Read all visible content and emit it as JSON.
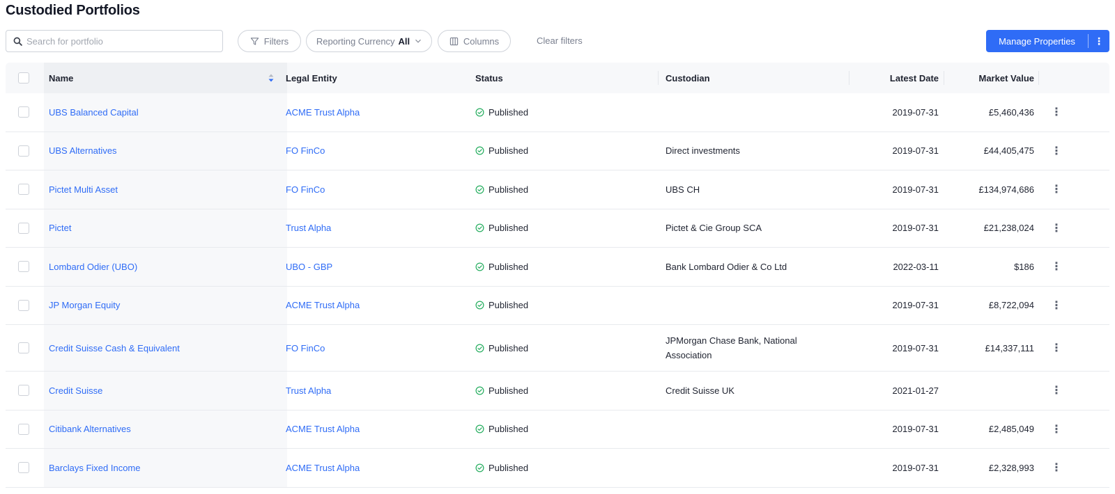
{
  "page": {
    "title": "Custodied Portfolios"
  },
  "toolbar": {
    "search_placeholder": "Search for portfolio",
    "filters_label": "Filters",
    "currency_label": "Reporting Currency",
    "currency_value": "All",
    "columns_label": "Columns",
    "clear_filters_label": "Clear filters",
    "manage_properties_label": "Manage Properties"
  },
  "table": {
    "headers": {
      "name": "Name",
      "legal_entity": "Legal Entity",
      "status": "Status",
      "custodian": "Custodian",
      "latest_date": "Latest Date",
      "market_value": "Market Value"
    },
    "rows": [
      {
        "name": "UBS Balanced Capital",
        "legal_entity": "ACME Trust Alpha",
        "status": "Published",
        "custodian": "",
        "latest_date": "2019-07-31",
        "market_value": "£5,460,436"
      },
      {
        "name": "UBS Alternatives",
        "legal_entity": "FO FinCo",
        "status": "Published",
        "custodian": "Direct investments",
        "latest_date": "2019-07-31",
        "market_value": "£44,405,475"
      },
      {
        "name": "Pictet Multi Asset",
        "legal_entity": "FO FinCo",
        "status": "Published",
        "custodian": "UBS CH",
        "latest_date": "2019-07-31",
        "market_value": "£134,974,686"
      },
      {
        "name": "Pictet",
        "legal_entity": "Trust Alpha",
        "status": "Published",
        "custodian": "Pictet & Cie Group SCA",
        "latest_date": "2019-07-31",
        "market_value": "£21,238,024"
      },
      {
        "name": "Lombard Odier (UBO)",
        "legal_entity": "UBO - GBP",
        "status": "Published",
        "custodian": "Bank Lombard Odier & Co Ltd",
        "latest_date": "2022-03-11",
        "market_value": "$186"
      },
      {
        "name": "JP Morgan Equity",
        "legal_entity": "ACME Trust Alpha",
        "status": "Published",
        "custodian": "",
        "latest_date": "2019-07-31",
        "market_value": "£8,722,094"
      },
      {
        "name": "Credit Suisse Cash & Equivalent",
        "legal_entity": "FO FinCo",
        "status": "Published",
        "custodian": "JPMorgan Chase Bank, National Association",
        "latest_date": "2019-07-31",
        "market_value": "£14,337,111"
      },
      {
        "name": "Credit Suisse",
        "legal_entity": "Trust Alpha",
        "status": "Published",
        "custodian": "Credit Suisse UK",
        "latest_date": "2021-01-27",
        "market_value": ""
      },
      {
        "name": "Citibank Alternatives",
        "legal_entity": "ACME Trust Alpha",
        "status": "Published",
        "custodian": "",
        "latest_date": "2019-07-31",
        "market_value": "£2,485,049"
      },
      {
        "name": "Barclays Fixed Income",
        "legal_entity": "ACME Trust Alpha",
        "status": "Published",
        "custodian": "",
        "latest_date": "2019-07-31",
        "market_value": "£2,328,993"
      }
    ]
  },
  "colors": {
    "accent": "#2f6cf6",
    "status_ok": "#27ae60",
    "header_bg": "#f7f8fa"
  },
  "icons": [
    "search-icon",
    "filter-icon",
    "chevron-down-icon",
    "columns-icon",
    "kebab-icon",
    "sort-icon",
    "check-circle-icon"
  ]
}
